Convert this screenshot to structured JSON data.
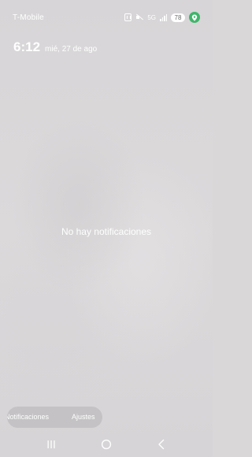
{
  "status_bar": {
    "carrier": "T-Mobile",
    "network": "5G",
    "battery": "78",
    "icons": [
      "nfc-icon",
      "mute-icon",
      "signal-icon",
      "location-icon"
    ]
  },
  "lockscreen": {
    "time": "6:12",
    "date": "mié, 27 de ago"
  },
  "notifications": {
    "empty_message": "No hay notificaciones"
  },
  "bottom_buttons": {
    "left_label": "Notificaciones",
    "right_label": "Ajustes"
  },
  "nav_bar": {
    "icons": [
      "recents-icon",
      "home-icon",
      "back-icon"
    ]
  },
  "colors": {
    "background": "#d9d7d8",
    "text": "#ffffff",
    "location_badge": "#3fb56a",
    "pill": "#c4c2c4"
  }
}
